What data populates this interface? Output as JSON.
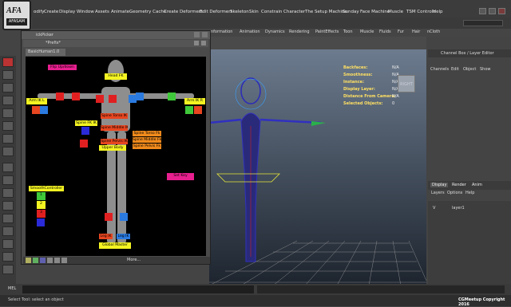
{
  "menubar": {
    "items": [
      "odify",
      "Create",
      "Display",
      "Window",
      "Assets",
      "Animate",
      "Geometry Cache",
      "Create Deformers",
      "Edit Deformers",
      "Skeleton",
      "Skin",
      "Constrain",
      "Character",
      "The Setup Machine",
      "Sunday",
      "Face Machine",
      "Muscle",
      "TSM Controls",
      "Help"
    ]
  },
  "logo": {
    "text_top": "AFA",
    "text_bottom": "AFASAM"
  },
  "shelf": {
    "tabs": [
      "nformation",
      "Animation",
      "Dynamics",
      "Rendering",
      "PaintEffects",
      "Toon",
      "Muscle",
      "Fluids",
      "Fur",
      "Hair",
      "nCloth"
    ]
  },
  "picker": {
    "title": "ickPicker",
    "tab": "*Prefix*",
    "sub_tab": "BasicHuman1.0",
    "buttons": {
      "flip_up": "Flip Up/down",
      "head_fk": "Head FK",
      "arm_ik_l": "Arm IK L",
      "arm_ik_r": "Arm IK R",
      "spine_fk_ik": "Spine FK IK",
      "spine_torso_ik": "Spine Torso IK",
      "spine_middle_ik": "Spine Middle IK",
      "spine_pelvis_ik": "Spine Pelvis IK",
      "spine_torso_fk": "Spine Torso Fk",
      "spine_middle_fk": "Spine Middle Fk",
      "spine_pelvis_fk": "Spine Pelvis Fk",
      "upper_body": "Upper Body",
      "set_key": "Set Key",
      "smooth_controller": "SmoothController",
      "smooth_1": "1",
      "smooth_2": "2",
      "smooth_3": "3",
      "global_master": "Global Master",
      "leg_ik_l": "Leg IK",
      "leg_ik_r": "Leg IK",
      "more": "More..."
    },
    "small_labels": {
      "fk": "FK",
      "ik": "IK"
    }
  },
  "viewport": {
    "labels": [
      "Backfaces:",
      "Smoothness:",
      "Instance:",
      "Display Layer:",
      "Distance From Camera:",
      "Selected Objects:"
    ],
    "values": [
      "N/A",
      "N/A",
      "N/A",
      "N/A",
      "N/A",
      "0"
    ],
    "cube_label": "RIGHT"
  },
  "channel_box": {
    "header": "Channel Box / Layer Editor",
    "menu": [
      "Channels",
      "Edit",
      "Object",
      "Show"
    ],
    "layer_tabs": [
      "Display",
      "Render",
      "Anim"
    ],
    "layer_menu": [
      "Layers",
      "Options",
      "Help"
    ],
    "layer_row": {
      "v": "V",
      "name": "layer1"
    }
  },
  "cmdline": {
    "label": "MEL"
  },
  "helpline": {
    "text": "Select Tool: select an object",
    "copyright": "CGMeetup Copyright 2016"
  }
}
